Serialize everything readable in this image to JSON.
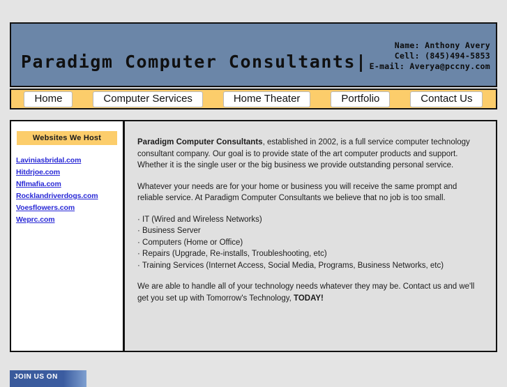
{
  "header": {
    "site_title": "Paradigm Computer Consultants|",
    "contact": {
      "name_line": "Name: Anthony Avery",
      "cell_line": "Cell: (845)494-5853",
      "email_line": "E-mail: Averya@pccny.com"
    },
    "banner_color": "#6b86a8"
  },
  "nav": {
    "accent_color": "#fccd6b",
    "items": [
      {
        "label": "Home"
      },
      {
        "label": "Computer Services"
      },
      {
        "label": "Home Theater"
      },
      {
        "label": "Portfolio"
      },
      {
        "label": "Contact Us"
      }
    ]
  },
  "sidebar": {
    "heading": "Websites We Host",
    "heading_color": "#fccd6b",
    "link_color": "#2929d6",
    "links": [
      {
        "label": "Laviniasbridal.com"
      },
      {
        "label": "Hitdrjoe.com"
      },
      {
        "label": "Nflmafia.com"
      },
      {
        "label": "Rocklandriverdogs.com"
      },
      {
        "label": "Voesflowers.com"
      },
      {
        "label": "Weprc.com"
      }
    ]
  },
  "content": {
    "intro_strong": "Paradigm Computer Consultants",
    "intro_rest": ", established in 2002, is a full service computer technology consultant company. Our goal is to provide state of the art computer products and support. Whether it is the single user or the big business we provide outstanding personal service.",
    "paragraph2": "Whatever your needs are for your home or business you will receive the same prompt and reliable service. At Paradigm Computer Consultants we believe that no job is too small.",
    "services": [
      {
        "label": "· IT (Wired and Wireless Networks)"
      },
      {
        "label": "· Business Server"
      },
      {
        "label": "· Computers (Home or Office)"
      },
      {
        "label": "· Repairs (Upgrade, Re-installs, Troubleshooting, etc)"
      },
      {
        "label": "· Training Services (Internet Access, Social Media, Programs, Business Networks, etc)"
      }
    ],
    "closing_text": "We are able to handle all of your technology needs whatever they may be. Contact us and we'll get you set up with Tomorrow's Technology, ",
    "closing_strong": "TODAY!"
  },
  "footer": {
    "join_label": "JOIN US ON",
    "banner_color": "#3a5a9b"
  }
}
